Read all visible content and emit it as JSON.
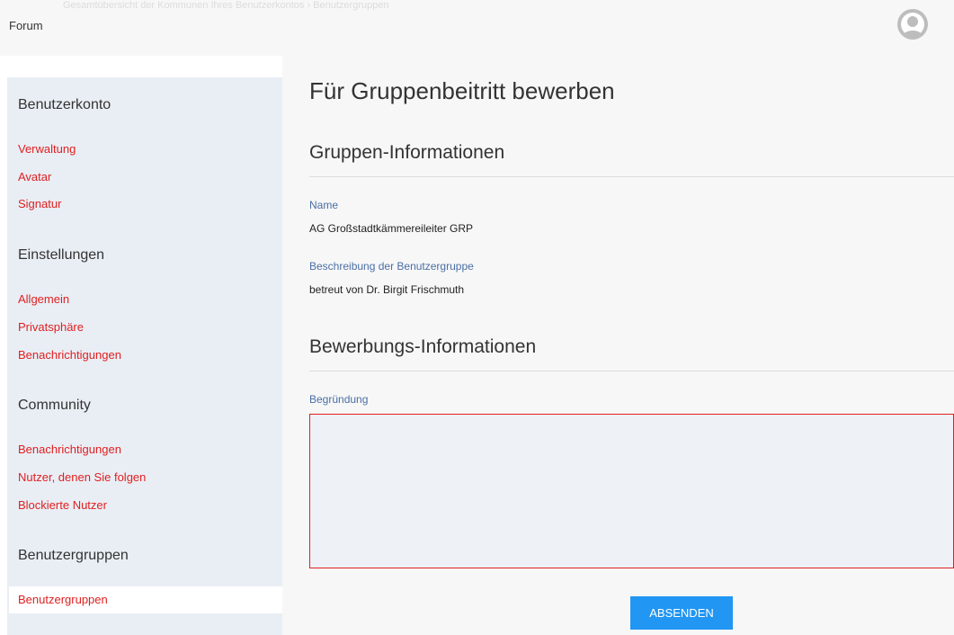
{
  "header": {
    "breadcrumb_faded": "Gesamtübersicht der Kommunen Ihres Benutzerkontos › Benutzergruppen",
    "forum_label": "Forum",
    "avatar_icon": "user-avatar-icon"
  },
  "sidebar": {
    "sections": [
      {
        "heading": "Benutzerkonto",
        "links": [
          "Verwaltung",
          "Avatar",
          "Signatur"
        ]
      },
      {
        "heading": "Einstellungen",
        "links": [
          "Allgemein",
          "Privatsphäre",
          "Benachrichtigungen"
        ]
      },
      {
        "heading": "Community",
        "links": [
          "Benachrichtigungen",
          "Nutzer, denen Sie folgen",
          "Blockierte Nutzer"
        ]
      },
      {
        "heading": "Benutzergruppen",
        "links": [
          "Benutzergruppen"
        ]
      }
    ],
    "active_link": "Benutzergruppen"
  },
  "main": {
    "title": "Für Gruppenbeitritt bewerben",
    "group_info": {
      "heading": "Gruppen-Informationen",
      "name_label": "Name",
      "name_value": "AG Großstadtkämmereileiter GRP",
      "desc_label": "Beschreibung der Benutzergruppe",
      "desc_value": "betreut von Dr. Birgit Frischmuth"
    },
    "application_info": {
      "heading": "Bewerbungs-Informationen",
      "reason_label": "Begründung",
      "reason_value": ""
    },
    "submit_label": "ABSENDEN"
  },
  "colors": {
    "link": "#e02020",
    "label": "#4a6fa5",
    "button": "#2196f3",
    "sidebar_bg": "#e9eef5"
  }
}
